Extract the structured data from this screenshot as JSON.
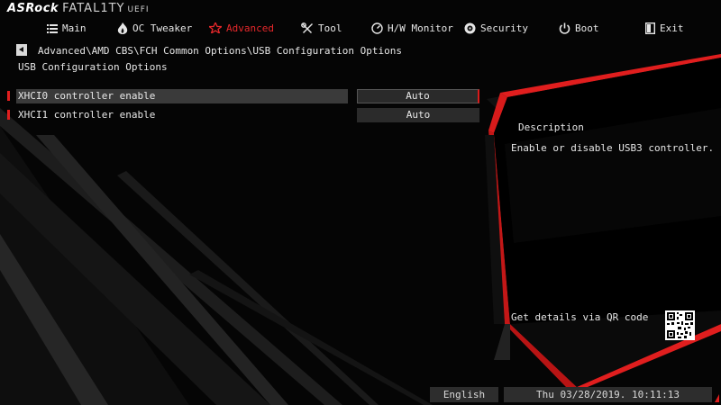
{
  "brand": {
    "name": "ASRock",
    "product": "FATAL1TY",
    "uefi": "UEFI"
  },
  "nav": {
    "tabs": [
      {
        "label": "Main",
        "icon": "list-icon",
        "active": false
      },
      {
        "label": "OC Tweaker",
        "icon": "flame-icon",
        "active": false
      },
      {
        "label": "Advanced",
        "icon": "star-icon",
        "active": true
      },
      {
        "label": "Tool",
        "icon": "wrench-icon",
        "active": false
      },
      {
        "label": "H/W Monitor",
        "icon": "monitor-icon",
        "active": false
      },
      {
        "label": "Security",
        "icon": "shield-icon",
        "active": false
      },
      {
        "label": "Boot",
        "icon": "power-icon",
        "active": false
      },
      {
        "label": "Exit",
        "icon": "exit-icon",
        "active": false
      }
    ]
  },
  "breadcrumb": "Advanced\\AMD CBS\\FCH Common Options\\USB Configuration Options",
  "page_title": "USB Configuration Options",
  "options": [
    {
      "label": "XHCI0 controller enable",
      "value": "Auto",
      "selected": true
    },
    {
      "label": "XHCI1 controller enable",
      "value": "Auto",
      "selected": false
    }
  ],
  "description": {
    "title": "Description",
    "text": "Enable or disable USB3 controller."
  },
  "qr": {
    "text": "Get details via QR code"
  },
  "footer": {
    "language": "English",
    "datetime": "Thu 03/28/2019. 10:11:13"
  },
  "colors": {
    "accent": "#e01e1e",
    "background": "#000000",
    "text": "#e6e6e6"
  }
}
